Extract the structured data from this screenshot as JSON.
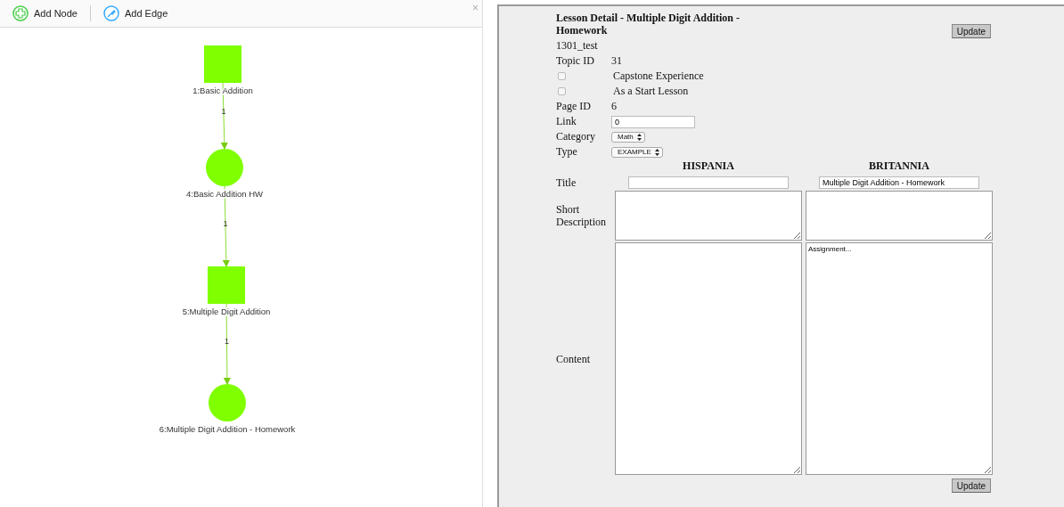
{
  "toolbar": {
    "buttons": [
      {
        "kind": "add-node",
        "label": "Add Node"
      },
      {
        "kind": "add-edge",
        "label": "Add Edge"
      }
    ],
    "close": "×"
  },
  "graph": {
    "nodes": [
      {
        "kind": "square",
        "label": "1:Basic Addition"
      },
      {
        "kind": "circle",
        "label": "4:Basic Addition HW"
      },
      {
        "kind": "square",
        "label": "5:Multiple Digit Addition"
      },
      {
        "kind": "circle",
        "label": "6:Multiple Digit Addition - Homework"
      }
    ],
    "edges": [
      {
        "label": "1"
      },
      {
        "label": "1"
      },
      {
        "label": "1"
      }
    ]
  },
  "lesson": {
    "title": "Lesson Detail - Multiple Digit Addition - Homework",
    "code": "1301_test",
    "update_button": "Update",
    "fields": [
      {
        "kind": "text",
        "label": "Topic ID",
        "value": "31"
      },
      {
        "kind": "checkbox",
        "label": "Capstone Experience",
        "checked": false
      },
      {
        "kind": "checkbox",
        "label": "As a Start Lesson",
        "checked": false
      },
      {
        "kind": "text",
        "label": "Page ID",
        "value": "6"
      },
      {
        "kind": "input",
        "label": "Link",
        "value": "0"
      },
      {
        "kind": "select",
        "label": "Category",
        "value": "Math"
      },
      {
        "kind": "select",
        "label": "Type",
        "value": "EXAMPLE"
      }
    ],
    "languages": [
      {
        "name": "HISPANIA"
      },
      {
        "name": "BRITANNIA",
        "title": "Multiple Digit Addition - Homework",
        "content": "Assignment..."
      }
    ],
    "row_labels": {
      "title": "Title",
      "short_description": "Short Description",
      "content": "Content"
    },
    "bottom_button": "Update"
  }
}
